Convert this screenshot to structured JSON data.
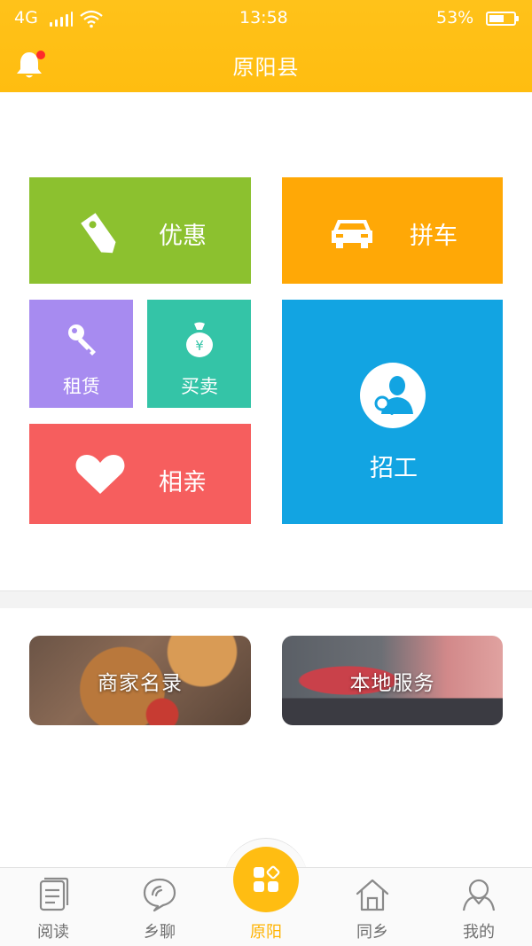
{
  "status_bar": {
    "network": "4G",
    "time": "13:58",
    "battery_percent": "53%",
    "icons": [
      "signal-icon",
      "wifi-icon",
      "battery-icon"
    ]
  },
  "header": {
    "title": "原阳县",
    "left_icon": "bell-icon",
    "has_notification_dot": true
  },
  "tiles": {
    "coupon": {
      "label": "优惠",
      "icon": "price-tag-icon",
      "color": "#8cc12f"
    },
    "carpool": {
      "label": "拼车",
      "icon": "car-icon",
      "color": "#ffa806"
    },
    "rent": {
      "label": "租赁",
      "icon": "key-icon",
      "color": "#a78bf0"
    },
    "trade": {
      "label": "买卖",
      "icon": "money-bag-icon",
      "color": "#34c4a7"
    },
    "dating": {
      "label": "相亲",
      "icon": "heart-icon",
      "color": "#f65e5e"
    },
    "hiring": {
      "label": "招工",
      "icon": "person-search-icon",
      "color": "#12a4e2"
    }
  },
  "banners": {
    "merchant": {
      "label": "商家名录"
    },
    "local_service": {
      "label": "本地服务"
    }
  },
  "bottom_nav": {
    "items": [
      {
        "label": "阅读",
        "icon": "document-icon",
        "active": false
      },
      {
        "label": "乡聊",
        "icon": "chat-icon",
        "active": false
      },
      {
        "label": "原阳",
        "icon": "apps-icon",
        "active": true
      },
      {
        "label": "同乡",
        "icon": "home-icon",
        "active": false
      },
      {
        "label": "我的",
        "icon": "user-icon",
        "active": false
      }
    ]
  },
  "colors": {
    "accent": "#ffbd12",
    "nav_inactive": "#707070"
  }
}
